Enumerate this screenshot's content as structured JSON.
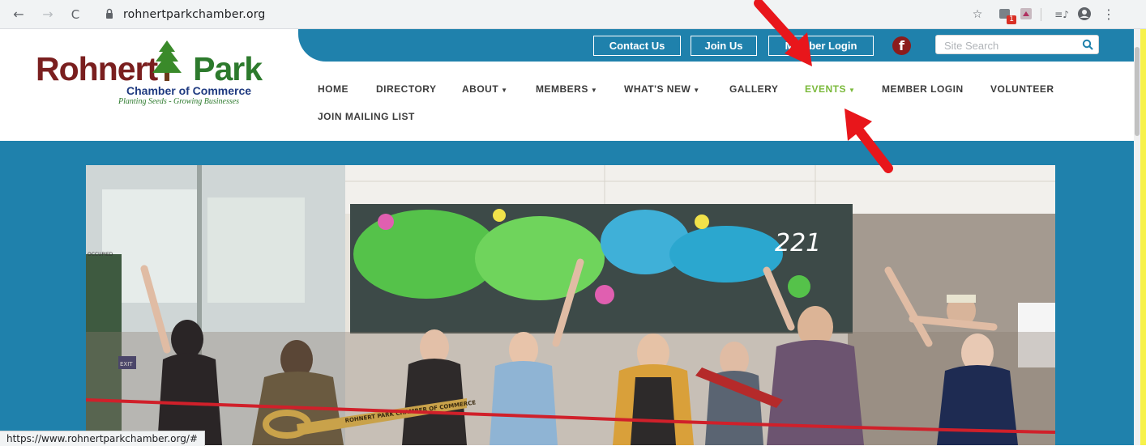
{
  "browser": {
    "url": "rohnertparkchamber.org",
    "back_icon": "←",
    "forward_icon": "→",
    "reload_icon": "C",
    "star_icon": "☆",
    "ext_badge": "1",
    "menu_icon": "⋮",
    "playlist_icon": "≡♪",
    "status_url": "https://www.rohnertparkchamber.org/#"
  },
  "logo": {
    "name_part1": "Rohnert",
    "name_part2": "Park",
    "subtitle": "Chamber of Commerce",
    "tagline": "Planting Seeds - Growing Businesses"
  },
  "topbar": {
    "contact": "Contact Us",
    "join": "Join Us",
    "member_login": "Member Login",
    "facebook": "f",
    "search_placeholder": "Site Search"
  },
  "nav": {
    "items": [
      {
        "label": "HOME"
      },
      {
        "label": "DIRECTORY"
      },
      {
        "label": "ABOUT"
      },
      {
        "label": "MEMBERS"
      },
      {
        "label": "WHAT'S NEW"
      },
      {
        "label": "GALLERY"
      },
      {
        "label": "EVENTS"
      },
      {
        "label": "MEMBER LOGIN"
      },
      {
        "label": "VOLUNTEER"
      },
      {
        "label": "JOIN MAILING LIST"
      }
    ]
  },
  "photo": {
    "wall_number": "221",
    "exit_sign": "EXIT",
    "door_sign": "OCCUPIED",
    "scissors_text": "ROHNERT PARK CHAMBER OF COMMERCE"
  },
  "colors": {
    "brand_blue": "#1f81ac",
    "brand_red": "#7a1f1f",
    "brand_green": "#2d7a2d",
    "active_nav": "#7ab93a",
    "annotation_arrow": "#e8161b"
  }
}
